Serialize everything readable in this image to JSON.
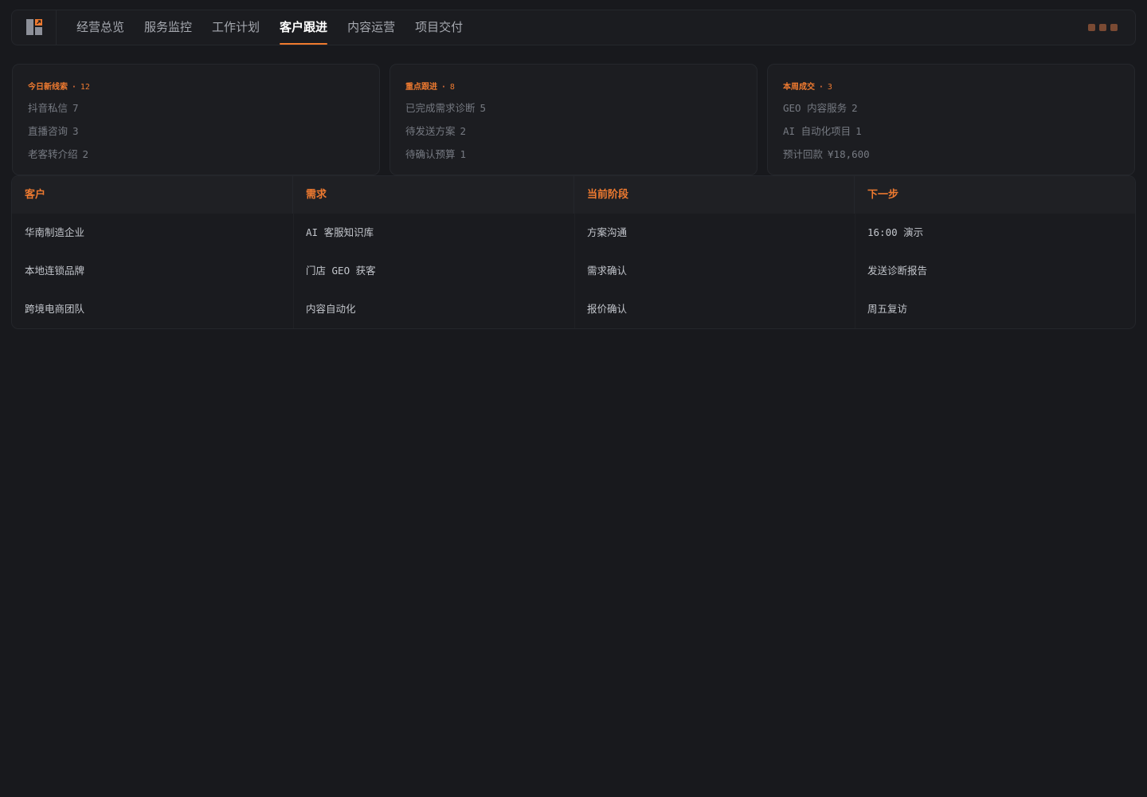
{
  "nav": {
    "logo_icon": "dashboard-logo-icon",
    "tabs": [
      {
        "label": "经营总览",
        "active": false
      },
      {
        "label": "服务监控",
        "active": false
      },
      {
        "label": "工作计划",
        "active": false
      },
      {
        "label": "客户跟进",
        "active": true
      },
      {
        "label": "内容运营",
        "active": false
      },
      {
        "label": "项目交付",
        "active": false
      }
    ],
    "window_controls": [
      "minimize",
      "maximize",
      "close"
    ]
  },
  "cards": [
    {
      "title": "今日新线索",
      "count": "12",
      "rows": [
        {
          "label": "抖音私信",
          "value": "7"
        },
        {
          "label": "直播咨询",
          "value": "3"
        },
        {
          "label": "老客转介绍",
          "value": "2"
        }
      ]
    },
    {
      "title": "重点跟进",
      "count": "8",
      "rows": [
        {
          "label": "已完成需求诊断",
          "value": "5"
        },
        {
          "label": "待发送方案",
          "value": "2"
        },
        {
          "label": "待确认预算",
          "value": "1"
        }
      ]
    },
    {
      "title": "本周成交",
      "count": "3",
      "rows": [
        {
          "label": "GEO 内容服务",
          "value": "2"
        },
        {
          "label": "AI 自动化项目",
          "value": "1"
        },
        {
          "label": "预计回款",
          "value": "¥18,600"
        }
      ]
    }
  ],
  "table": {
    "headers": [
      "客户",
      "需求",
      "当前阶段",
      "下一步"
    ],
    "rows": [
      [
        "华南制造企业",
        "AI 客服知识库",
        "方案沟通",
        "16:00 演示"
      ],
      [
        "本地连锁品牌",
        "门店 GEO 获客",
        "需求确认",
        "发送诊断报告"
      ],
      [
        "跨境电商团队",
        "内容自动化",
        "报价确认",
        "周五复访"
      ]
    ]
  },
  "colors": {
    "accent": "#ee7a30",
    "background": "#18191d",
    "panel": "#1c1d21"
  }
}
